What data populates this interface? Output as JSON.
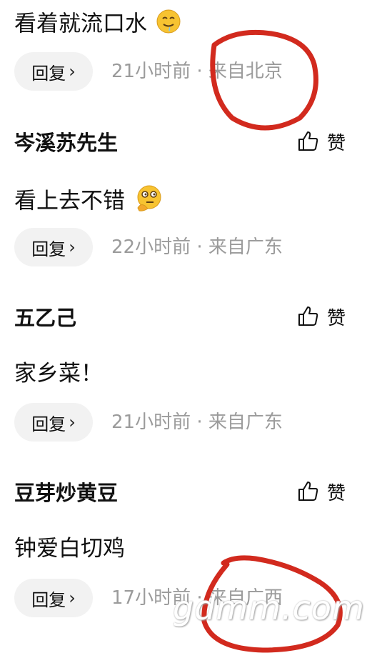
{
  "comments": [
    {
      "text": "看着就流口水",
      "emoji": "drooling-face",
      "reply_label": "回复",
      "time": "21小时前",
      "location": "来自北京"
    },
    {
      "author": "岑溪苏先生",
      "like_label": "赞",
      "text": "看上去不错",
      "emoji": "thinking-face",
      "reply_label": "回复",
      "time": "22小时前",
      "location": "来自广东"
    },
    {
      "author": "五乙己",
      "like_label": "赞",
      "text": "家乡菜！",
      "reply_label": "回复",
      "time": "21小时前",
      "location": "来自广东"
    },
    {
      "author": "豆芽炒黄豆",
      "like_label": "赞",
      "text": "钟爱白切鸡",
      "reply_label": "回复",
      "time": "17小时前",
      "location": "来自广西"
    }
  ],
  "separator": "·",
  "watermark": "gdmm.com",
  "colors": {
    "annotation": "#d22a1e",
    "meta_text": "#9b9b9b",
    "reply_bg": "#f2f2f2"
  }
}
